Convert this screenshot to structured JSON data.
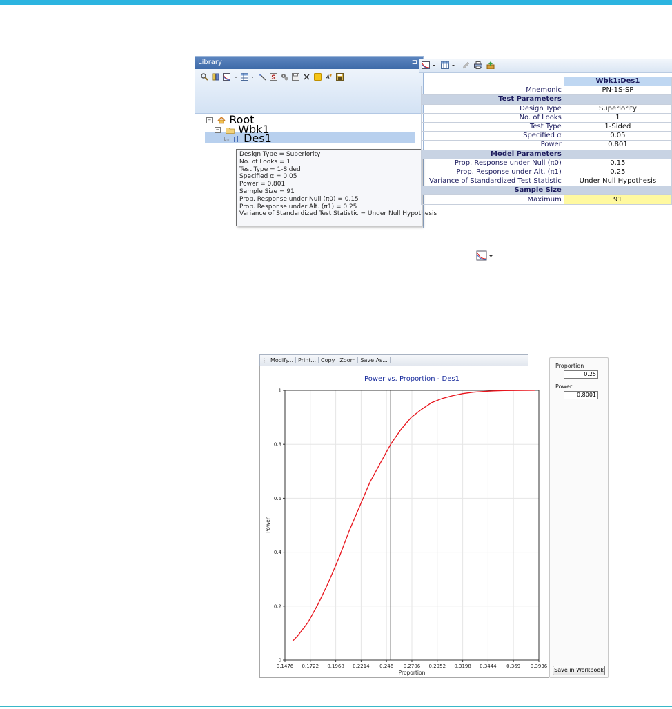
{
  "library": {
    "title": "Library",
    "pin": "⊐",
    "tree": {
      "root": "Root",
      "workbook": "Wbk1",
      "design": "Des1"
    }
  },
  "tooltip": {
    "lines": [
      "Design Type = Superiority",
      "No. of Looks = 1",
      "Test Type = 1-Sided",
      "Specified α = 0.05",
      "Power = 0.801",
      "Sample Size = 91",
      "Prop. Response under Null (π0) = 0.15",
      "Prop. Response under Alt. (π1) = 0.25",
      "Variance of Standardized Test Statistic = Under Null Hypothesis"
    ]
  },
  "design_table": {
    "column_header": "Wbk1:Des1",
    "mnemonic_label": "Mnemonic",
    "mnemonic_value": "PN-1S-SP",
    "section_test": "Test Parameters",
    "design_type_label": "Design Type",
    "design_type_value": "Superiority",
    "looks_label": "No. of Looks",
    "looks_value": "1",
    "test_type_label": "Test Type",
    "test_type_value": "1-Sided",
    "alpha_label": "Specified α",
    "alpha_value": "0.05",
    "power_label": "Power",
    "power_value": "0.801",
    "section_model": "Model Parameters",
    "null_label": "Prop. Response under Null (π0)",
    "null_value": "0.15",
    "alt_label": "Prop. Response under Alt. (π1)",
    "alt_value": "0.25",
    "variance_label": "Variance of Standardized Test Statistic",
    "variance_value": "Under Null Hypothesis",
    "section_sample": "Sample Size",
    "maximum_label": "Maximum",
    "maximum_value": "91"
  },
  "chart_window": {
    "toolbar": [
      "Modify...",
      "Print...",
      "Copy",
      "Zoom",
      "Save As..."
    ],
    "side": {
      "proportion_label": "Proportion",
      "proportion_value": "0.25",
      "power_label": "Power",
      "power_value": "0.8001",
      "save_button": "Save in Workbook"
    }
  },
  "chart_data": {
    "type": "line",
    "title": "Power vs. Proportion - Des1",
    "xlabel": "Proportion",
    "ylabel": "Power",
    "xlim": [
      0.1476,
      0.3936
    ],
    "ylim": [
      0,
      1
    ],
    "x_ticks": [
      "0.1476",
      "0.1722",
      "0.1968",
      "0.2214",
      "0.246",
      "0.2706",
      "0.2952",
      "0.3198",
      "0.3444",
      "0.369",
      "0.3936"
    ],
    "y_ticks": [
      "0",
      "0.2",
      "0.4",
      "0.6",
      "0.8",
      "1"
    ],
    "grid": true,
    "line_color": "#e8141c",
    "marker_x": 0.25,
    "series": [
      {
        "x": [
          0.155,
          0.16,
          0.17,
          0.18,
          0.19,
          0.2,
          0.21,
          0.22,
          0.23,
          0.24,
          0.25,
          0.26,
          0.27,
          0.28,
          0.29,
          0.3,
          0.31,
          0.32,
          0.33,
          0.34,
          0.35,
          0.36,
          0.37,
          0.38,
          0.39
        ],
        "values": [
          0.07,
          0.09,
          0.14,
          0.21,
          0.29,
          0.38,
          0.48,
          0.57,
          0.66,
          0.73,
          0.8,
          0.855,
          0.9,
          0.93,
          0.955,
          0.97,
          0.98,
          0.988,
          0.993,
          0.996,
          0.998,
          0.999,
          0.9995,
          0.9998,
          1.0
        ]
      }
    ]
  }
}
